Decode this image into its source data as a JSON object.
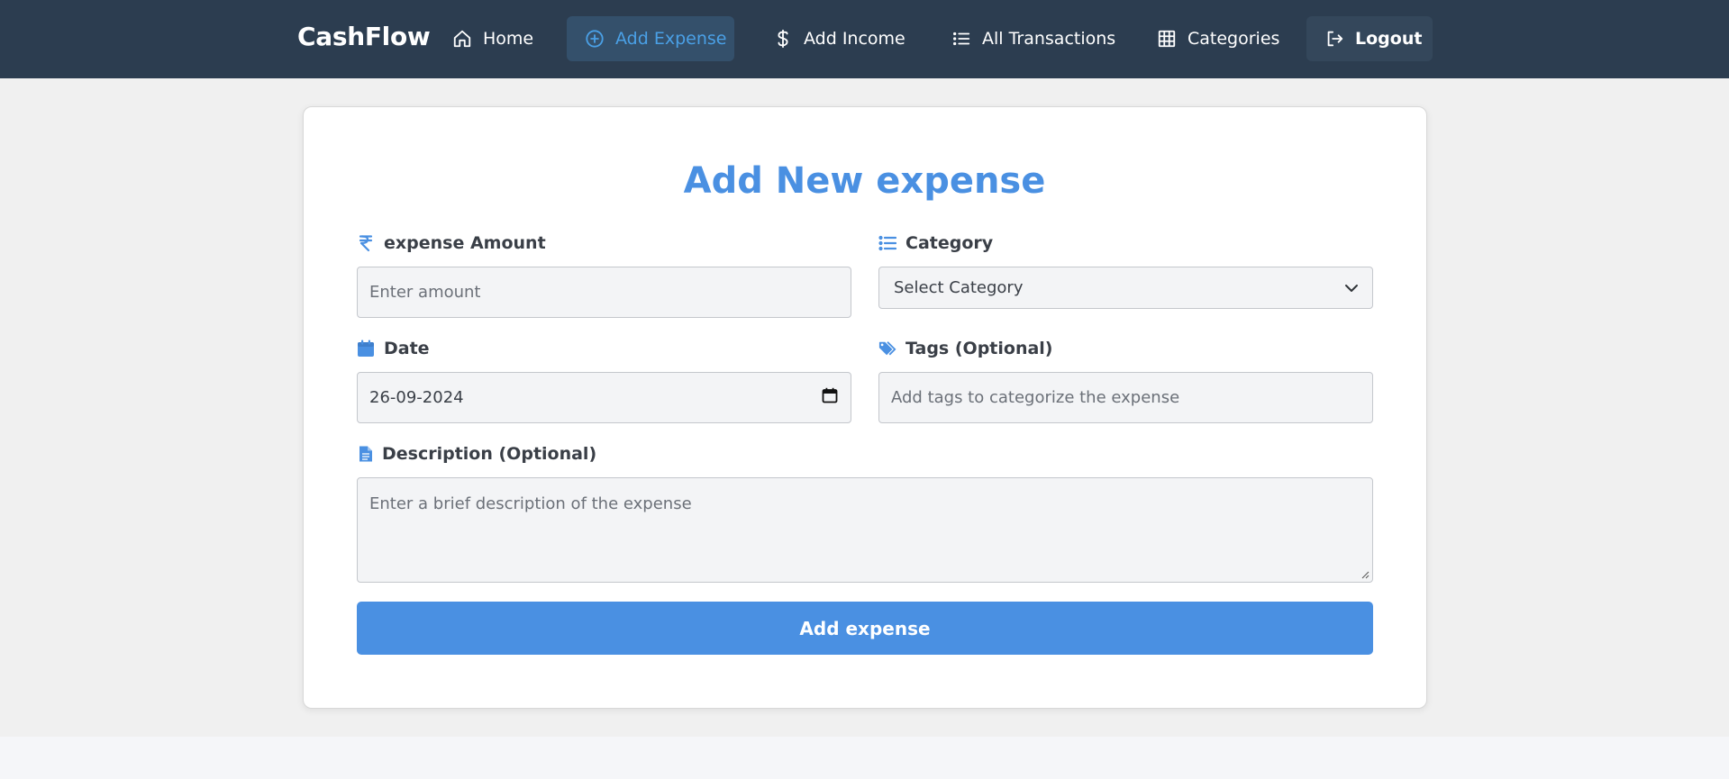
{
  "nav": {
    "brand": "CashFlow",
    "items": [
      {
        "label": "Home",
        "icon": "home-icon"
      },
      {
        "label": "Add Expense",
        "icon": "plus-circle-icon",
        "active": true
      },
      {
        "label": "Add Income",
        "icon": "dollar-icon"
      },
      {
        "label": "All Transactions",
        "icon": "list-icon"
      },
      {
        "label": "Categories",
        "icon": "grid-icon"
      },
      {
        "label": "Logout",
        "icon": "logout-icon"
      }
    ]
  },
  "form": {
    "title": "Add New expense",
    "amount": {
      "label": "expense Amount",
      "icon": "rupee-icon",
      "placeholder": "Enter amount"
    },
    "category": {
      "label": "Category",
      "icon": "list-icon",
      "selected": "Select Category"
    },
    "date": {
      "label": "Date",
      "icon": "calendar-icon",
      "value": "26-09-2024"
    },
    "tags": {
      "label": "Tags (Optional)",
      "icon": "tags-icon",
      "placeholder": "Add tags to categorize the expense"
    },
    "description": {
      "label": "Description (Optional)",
      "icon": "file-icon",
      "placeholder": "Enter a brief description of the expense"
    },
    "submit_label": "Add expense"
  },
  "colors": {
    "navbar": "#2c3d50",
    "accent": "#4a90e2",
    "active_nav_text": "#4aa0e6",
    "page_bg": "#f0f0f0"
  }
}
